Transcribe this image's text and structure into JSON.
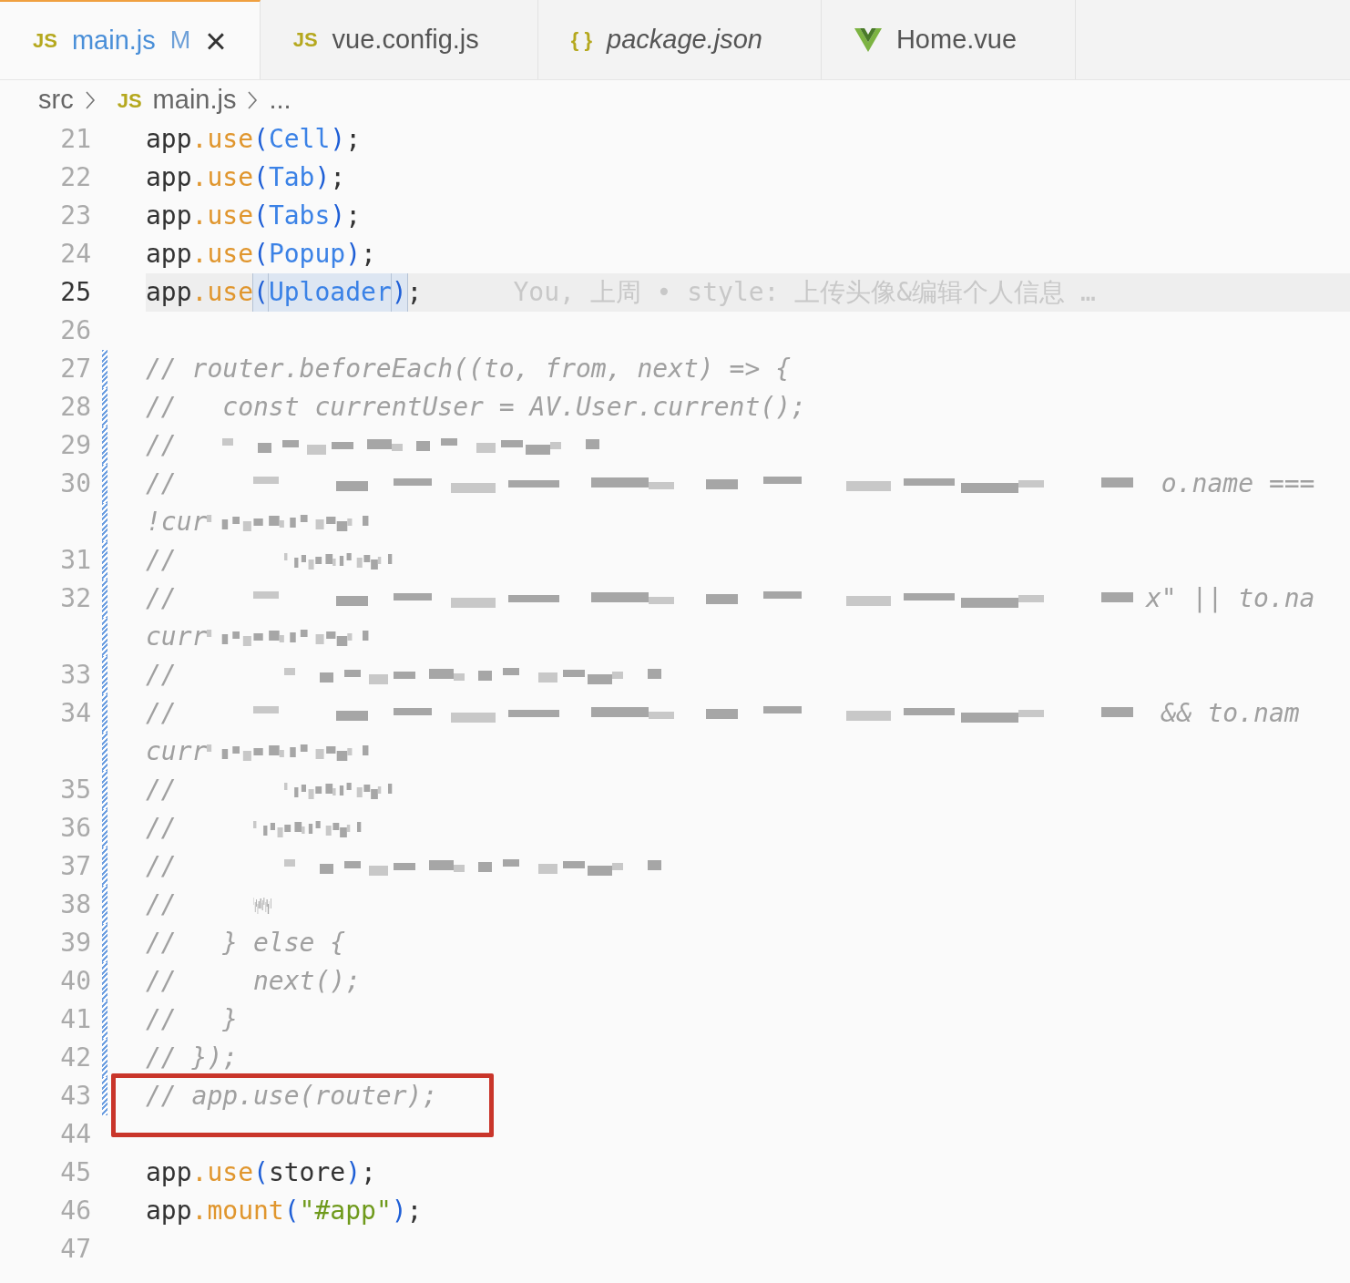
{
  "tabs": [
    {
      "icon": "JS",
      "kind": "js",
      "label": "main.js",
      "badge": "M",
      "close": "×",
      "selected": true,
      "italic": false
    },
    {
      "icon": "JS",
      "kind": "js",
      "label": "vue.config.js",
      "selected": false,
      "italic": false
    },
    {
      "icon": "{ }",
      "kind": "json",
      "label": "package.json",
      "selected": false,
      "italic": true
    },
    {
      "kind": "vue",
      "label": "Home.vue",
      "selected": false,
      "italic": false
    }
  ],
  "breadcrumb": {
    "folder": "src",
    "file_icon": "JS",
    "file": "main.js",
    "more": "..."
  },
  "lines": [
    {
      "number": "21",
      "current": false,
      "modified": false,
      "tokens": [
        {
          "kind": "plain",
          "text": "app"
        },
        {
          "kind": "method",
          "text": ".use"
        },
        {
          "kind": "punct",
          "text": "("
        },
        {
          "kind": "ident",
          "text": "Cell"
        },
        {
          "kind": "punct",
          "text": ")"
        },
        {
          "kind": "plain",
          "text": ";"
        }
      ]
    },
    {
      "number": "22",
      "current": false,
      "modified": false,
      "tokens": [
        {
          "kind": "plain",
          "text": "app"
        },
        {
          "kind": "method",
          "text": ".use"
        },
        {
          "kind": "punct",
          "text": "("
        },
        {
          "kind": "ident",
          "text": "Tab"
        },
        {
          "kind": "punct",
          "text": ")"
        },
        {
          "kind": "plain",
          "text": ";"
        }
      ]
    },
    {
      "number": "23",
      "current": false,
      "modified": false,
      "tokens": [
        {
          "kind": "plain",
          "text": "app"
        },
        {
          "kind": "method",
          "text": ".use"
        },
        {
          "kind": "punct",
          "text": "("
        },
        {
          "kind": "ident",
          "text": "Tabs"
        },
        {
          "kind": "punct",
          "text": ")"
        },
        {
          "kind": "plain",
          "text": ";"
        }
      ]
    },
    {
      "number": "24",
      "current": false,
      "modified": false,
      "tokens": [
        {
          "kind": "plain",
          "text": "app"
        },
        {
          "kind": "method",
          "text": ".use"
        },
        {
          "kind": "punct",
          "text": "("
        },
        {
          "kind": "ident",
          "text": "Popup"
        },
        {
          "kind": "punct",
          "text": ")"
        },
        {
          "kind": "plain",
          "text": ";"
        }
      ]
    },
    {
      "number": "25",
      "current": true,
      "modified": false,
      "blame": "You, 上周 • style: 上传头像&编辑个人信息 …",
      "tokens": [
        {
          "kind": "plain",
          "text": "app",
          "highlighted": false
        },
        {
          "kind": "method",
          "text": ".use",
          "highlighted": false
        },
        {
          "kind": "punct",
          "text": "(",
          "highlighted": true
        },
        {
          "kind": "ident",
          "text": "Uploader",
          "highlighted": true
        },
        {
          "kind": "punct",
          "text": ")",
          "highlighted": true
        },
        {
          "kind": "plain",
          "text": ";",
          "highlighted": false
        }
      ]
    },
    {
      "number": "26",
      "current": false,
      "modified": false
    },
    {
      "number": "27",
      "current": false,
      "modified": true,
      "tokens": [
        {
          "kind": "comment",
          "text": "// router.beforeEach((to, from, next) => {"
        }
      ]
    },
    {
      "number": "28",
      "current": false,
      "modified": true,
      "tokens": [
        {
          "kind": "comment",
          "text": "//   const currentUser = AV.User.current();"
        }
      ]
    },
    {
      "number": "29",
      "current": false,
      "modified": true,
      "tokens": [
        {
          "kind": "comment",
          "text": "//   "
        },
        {
          "kind": "redacted_medium"
        }
      ]
    },
    {
      "number": "30",
      "current": false,
      "modified": true,
      "tokens": [
        {
          "kind": "comment",
          "text": "//     "
        },
        {
          "kind": "redacted_huge"
        },
        {
          "kind": "comment",
          "text": " o.name ==="
        }
      ]
    },
    {
      "modified": true,
      "tokens": [
        {
          "kind": "comment",
          "text": "!cur"
        },
        {
          "kind": "redacted_short"
        }
      ]
    },
    {
      "number": "31",
      "current": false,
      "modified": true,
      "tokens": [
        {
          "kind": "comment",
          "text": "//       "
        },
        {
          "kind": "redacted_small"
        }
      ]
    },
    {
      "number": "32",
      "current": false,
      "modified": true,
      "tokens": [
        {
          "kind": "comment",
          "text": "//     "
        },
        {
          "kind": "redacted_huge"
        },
        {
          "kind": "comment",
          "text": "x\" || to.na"
        }
      ]
    },
    {
      "modified": true,
      "tokens": [
        {
          "kind": "comment",
          "text": "curr"
        },
        {
          "kind": "redacted_short"
        }
      ]
    },
    {
      "number": "33",
      "current": false,
      "modified": true,
      "tokens": [
        {
          "kind": "comment",
          "text": "//       "
        },
        {
          "kind": "redacted_medium"
        }
      ]
    },
    {
      "number": "34",
      "current": false,
      "modified": true,
      "tokens": [
        {
          "kind": "comment",
          "text": "//     "
        },
        {
          "kind": "redacted_huge"
        },
        {
          "kind": "comment",
          "text": " && to.nam"
        }
      ]
    },
    {
      "modified": true,
      "tokens": [
        {
          "kind": "comment",
          "text": "curr"
        },
        {
          "kind": "redacted_short"
        }
      ]
    },
    {
      "number": "35",
      "current": false,
      "modified": true,
      "tokens": [
        {
          "kind": "comment",
          "text": "//       "
        },
        {
          "kind": "redacted_small"
        }
      ]
    },
    {
      "number": "36",
      "current": false,
      "modified": true,
      "tokens": [
        {
          "kind": "comment",
          "text": "//     "
        },
        {
          "kind": "redacted_small"
        }
      ]
    },
    {
      "number": "37",
      "current": false,
      "modified": true,
      "tokens": [
        {
          "kind": "comment",
          "text": "//       "
        },
        {
          "kind": "redacted_medium"
        }
      ]
    },
    {
      "number": "38",
      "current": false,
      "modified": true,
      "tokens": [
        {
          "kind": "comment",
          "text": "//     "
        },
        {
          "kind": "redacted_tiny"
        }
      ]
    },
    {
      "number": "39",
      "current": false,
      "modified": true,
      "tokens": [
        {
          "kind": "comment",
          "text": "//   } else {"
        }
      ]
    },
    {
      "number": "40",
      "current": false,
      "modified": true,
      "tokens": [
        {
          "kind": "comment",
          "text": "//     next();"
        }
      ]
    },
    {
      "number": "41",
      "current": false,
      "modified": true,
      "tokens": [
        {
          "kind": "comment",
          "text": "//   }"
        }
      ]
    },
    {
      "number": "42",
      "current": false,
      "modified": true,
      "tokens": [
        {
          "kind": "comment",
          "text": "// });"
        }
      ]
    },
    {
      "number": "43",
      "current": false,
      "modified": true,
      "boxed": true,
      "tokens": [
        {
          "kind": "comment",
          "text": "// app.use(router);"
        }
      ]
    },
    {
      "number": "44",
      "current": false,
      "modified": false
    },
    {
      "number": "45",
      "current": false,
      "modified": false,
      "tokens": [
        {
          "kind": "plain",
          "text": "app"
        },
        {
          "kind": "method",
          "text": ".use"
        },
        {
          "kind": "punct",
          "text": "("
        },
        {
          "kind": "plain",
          "text": "store"
        },
        {
          "kind": "punct",
          "text": ")"
        },
        {
          "kind": "plain",
          "text": ";"
        }
      ]
    },
    {
      "number": "46",
      "current": false,
      "modified": false,
      "tokens": [
        {
          "kind": "plain",
          "text": "app"
        },
        {
          "kind": "method",
          "text": ".mount"
        },
        {
          "kind": "punct",
          "text": "("
        },
        {
          "kind": "string",
          "text": "\"#app\""
        },
        {
          "kind": "punct",
          "text": ")"
        },
        {
          "kind": "plain",
          "text": ";"
        }
      ]
    },
    {
      "number": "47",
      "current": false,
      "modified": false
    }
  ],
  "annotation": {
    "kind": "rectangle",
    "color": "#c9352a"
  }
}
